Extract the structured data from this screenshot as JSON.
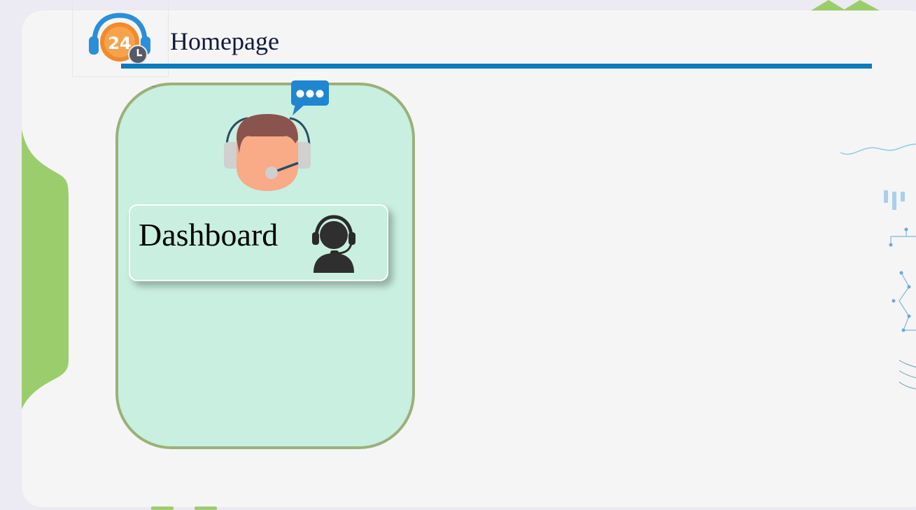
{
  "header": {
    "title": "Homepage",
    "logo_icon": "headset-24-hour-support-icon",
    "logo_text": "24"
  },
  "agent_card": {
    "avatar_icon": "support-agent-avatar-icon",
    "chat_bubble_icon": "chat-bubble-icon",
    "dashboard_button": {
      "label": "Dashboard",
      "icon": "headset-user-icon"
    }
  },
  "colors": {
    "accent_blue": "#0a7bc1",
    "card_fill": "#c8efe0",
    "card_border": "#9bb07a",
    "side_green": "#9ccd6d",
    "page_bg": "#f5f5f5"
  }
}
